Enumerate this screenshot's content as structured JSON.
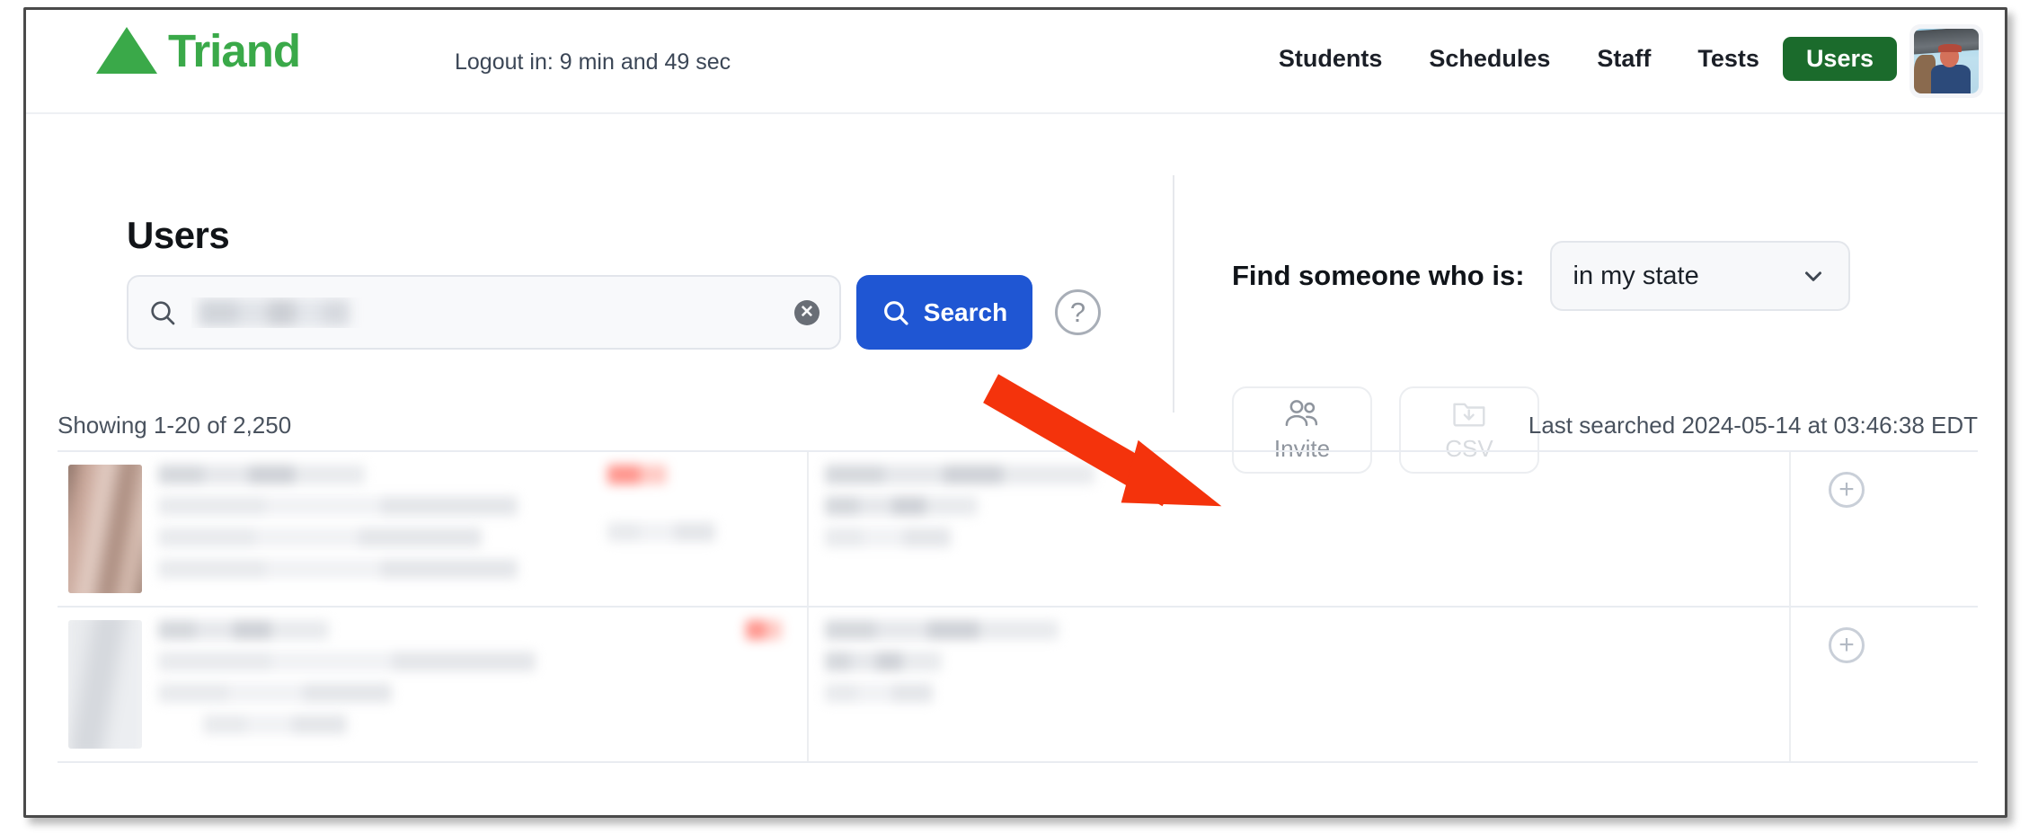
{
  "brand": {
    "name": "Triand",
    "logo_icon": "green-triangle-icon",
    "color": "#3aa949"
  },
  "topbar": {
    "logout_timer": "Logout in: 9 min and 49 sec",
    "nav_links": [
      {
        "label": "Students",
        "active": false
      },
      {
        "label": "Schedules",
        "active": false
      },
      {
        "label": "Staff",
        "active": false
      },
      {
        "label": "Tests",
        "active": false
      },
      {
        "label": "Users",
        "active": true
      }
    ],
    "active_nav_color": "#1b6b2c",
    "avatar_name": "user-avatar"
  },
  "search_panel": {
    "title": "Users",
    "search_icon": "magnifier-icon",
    "input_placeholder": "",
    "input_value": "",
    "input_value_redacted": true,
    "clear_icon": "clear-x-icon",
    "search_button_label": "Search",
    "search_button_icon": "magnifier-icon",
    "search_button_color": "#1f56d3",
    "help_icon_glyph": "?",
    "help_icon_name": "help-question-icon"
  },
  "filter_panel": {
    "label": "Find someone who is:",
    "select_value": "in my state",
    "select_caret_icon": "chevron-down-icon",
    "actions": [
      {
        "label": "Invite",
        "icon": "people-icon",
        "disabled": false
      },
      {
        "label": "CSV",
        "icon": "folder-download-icon",
        "disabled": true
      }
    ]
  },
  "results": {
    "showing_text": "Showing 1-20 of 2,250",
    "last_searched_text": "Last searched 2024-05-14 at 03:46:38 EDT",
    "add_icon": "plus-circle-icon",
    "rows": [
      {
        "photo": "redacted-person-photo",
        "redacted": true
      },
      {
        "photo": "redacted-person-photo",
        "redacted": true
      }
    ]
  },
  "annotation": {
    "arrow_color": "#f4330c",
    "points_to": "plus-circle-icon"
  }
}
